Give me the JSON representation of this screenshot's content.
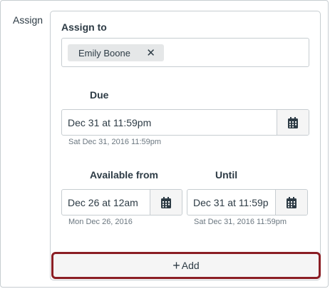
{
  "section_label": "Assign",
  "assign_to": {
    "label": "Assign to",
    "token": {
      "name": "Emily Boone",
      "remove_glyph": "✕"
    }
  },
  "due": {
    "label": "Due",
    "value": "Dec 31 at 11:59pm",
    "hint": "Sat Dec 31, 2016 11:59pm"
  },
  "available_from": {
    "label": "Available from",
    "value": "Dec 26 at 12am",
    "hint": "Mon Dec 26, 2016"
  },
  "until": {
    "label": "Until",
    "value": "Dec 31 at 11:59p",
    "hint": "Sat Dec 31, 2016 11:59pm"
  },
  "add_button": {
    "icon": "+",
    "label": "Add"
  },
  "colors": {
    "highlight_border": "#8b1e24",
    "text": "#2d3b45",
    "border": "#c7cdd1"
  }
}
